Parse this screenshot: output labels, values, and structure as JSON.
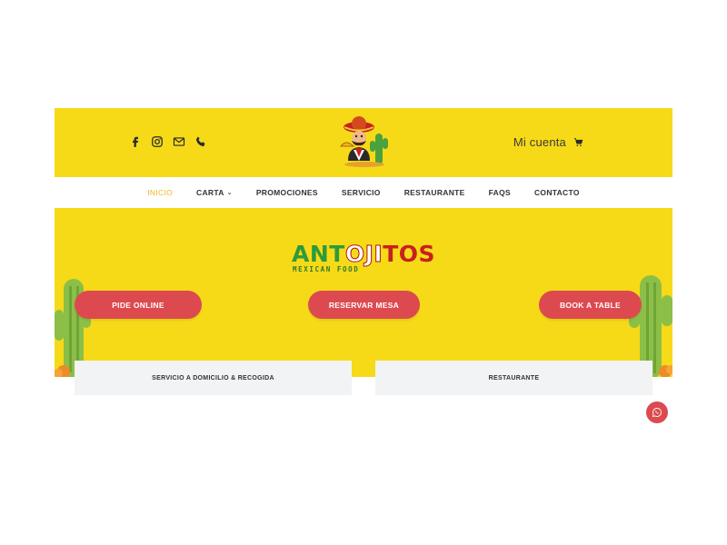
{
  "header": {
    "social_icons": [
      "facebook-icon",
      "instagram-icon",
      "email-icon",
      "phone-icon"
    ],
    "account_label": "Mi cuenta",
    "cart_icon": "cart-icon"
  },
  "nav": {
    "items": [
      {
        "label": "INICIO",
        "active": true
      },
      {
        "label": "CARTA",
        "has_dropdown": true
      },
      {
        "label": "PROMOCIONES"
      },
      {
        "label": "SERVICIO"
      },
      {
        "label": "RESTAURANTE"
      },
      {
        "label": "FAQS"
      },
      {
        "label": "CONTACTO"
      }
    ]
  },
  "hero": {
    "logo_part1": "ANT",
    "logo_part2": "OJI",
    "logo_part3": "TOS",
    "logo_sub": "MEXICAN FOOD",
    "buttons": [
      "PIDE ONLINE",
      "RESERVAR MESA",
      "BOOK A TABLE"
    ]
  },
  "cards": [
    "SERVICIO A DOMICILIO & RECOGIDA",
    "RESTAURANTE"
  ],
  "whatsapp_icon": "whatsapp-icon",
  "colors": {
    "yellow": "#f6da18",
    "accent_red": "#dc4a4f",
    "active_nav": "#f0b81c",
    "logo_green": "#2e9a3a",
    "logo_red": "#c8201f"
  }
}
